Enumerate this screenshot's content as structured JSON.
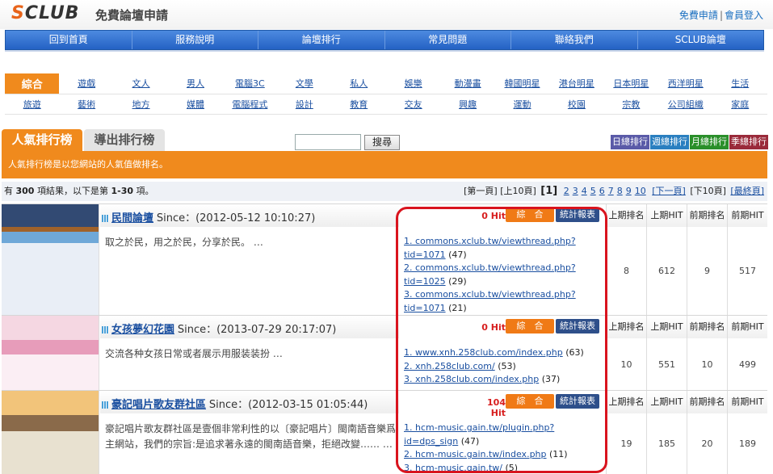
{
  "header": {
    "logo_s": "S",
    "logo_club": "CLUB",
    "slogan": "免費論壇申請",
    "link_free": "免費申請",
    "link_sep": "|",
    "link_login": "會員登入"
  },
  "mainnav": [
    "回到首頁",
    "服務說明",
    "論壇排行",
    "常見問題",
    "聯絡我們",
    "SCLUB論壇"
  ],
  "categories": {
    "row1": [
      "綜合",
      "遊戲",
      "文人",
      "男人",
      "電腦3C",
      "文學",
      "私人",
      "娛樂",
      "動漫畫",
      "韓國明星",
      "港台明星",
      "日本明星",
      "西洋明星",
      "生活"
    ],
    "row2": [
      "旅遊",
      "藝術",
      "地方",
      "媒體",
      "電腦程式",
      "設計",
      "教育",
      "交友",
      "興趣",
      "運動",
      "校園",
      "宗教",
      "公司組織",
      "家庭"
    ]
  },
  "tabs": {
    "active": "人氣排行榜",
    "inactive": "導出排行榜"
  },
  "search": {
    "button": "搜尋"
  },
  "rank_buttons": [
    {
      "label": "日總排行",
      "color": "#5a5aa8"
    },
    {
      "label": "週總排行",
      "color": "#2a7fc0"
    },
    {
      "label": "月總排行",
      "color": "#2a8f2a"
    },
    {
      "label": "季總排行",
      "color": "#9a2a3a"
    }
  ],
  "info_bar": "人氣排行榜是以您網站的人氣值做排名。",
  "results": {
    "prefix": "有",
    "total": "300",
    "middle": "項結果，以下是第",
    "range": "1-30",
    "suffix": "項。"
  },
  "pager": {
    "first": "[第一頁]",
    "prev10": "[上10頁]",
    "current": "[1]",
    "pages": [
      "2",
      "3",
      "4",
      "5",
      "6",
      "7",
      "8",
      "9",
      "10"
    ],
    "next": "[下一頁]",
    "next10": "[下10頁]",
    "last": "[最終頁]"
  },
  "stat_headers": [
    "上期排名",
    "上期HIT",
    "前期排名",
    "前期HIT"
  ],
  "listings": [
    {
      "name": "民間論壇",
      "since": "Since：(2012-05-12 10:10:27)",
      "desc": "取之於民，用之於民，分享於民。 …",
      "hit": "0 Hit",
      "summary_label": "綜　合",
      "stat_label": "統計報表",
      "refs": [
        {
          "url": "1. commons.xclub.tw/viewthread.php?tid=1071",
          "count": "(47)"
        },
        {
          "url": "2. commons.xclub.tw/viewthread.php?tid=1025",
          "count": "(29)"
        },
        {
          "url": "3. commons.xclub.tw/viewthread.php?tid=1071",
          "count": "(21)"
        }
      ],
      "stats": [
        "8",
        "612",
        "9",
        "517"
      ]
    },
    {
      "name": "女孩夢幻花園",
      "since": "Since：(2013-07-29 20:17:07)",
      "desc": "交流各种女孩日常或者展示用服装装扮 …",
      "hit": "0 Hit",
      "summary_label": "綜　合",
      "stat_label": "統計報表",
      "refs": [
        {
          "url": "1. www.xnh.258club.com/index.php",
          "count": "(63)"
        },
        {
          "url": "2. xnh.258club.com/",
          "count": "(53)"
        },
        {
          "url": "3. xnh.258club.com/index.php",
          "count": "(37)"
        }
      ],
      "stats": [
        "10",
        "551",
        "10",
        "499"
      ]
    },
    {
      "name": "豪記唱片歌友群社區",
      "since": "Since：(2012-03-15 01:05:44)",
      "desc": "豪記唱片歌友群社區是壹個非常利性的以〔豪記唱片〕閩南語音樂爲主網站，我們的宗旨:是追求著永遠的閩南語音樂，拒絕改變…… …",
      "hit": "104 Hit",
      "summary_label": "綜　合",
      "stat_label": "統計報表",
      "refs": [
        {
          "url": "1. hcm-music.gain.tw/plugin.php?id=dps_sign",
          "count": "(47)"
        },
        {
          "url": "2. hcm-music.gain.tw/index.php",
          "count": "(11)"
        },
        {
          "url": "3. hcm-music.gain.tw/",
          "count": "(5)"
        }
      ],
      "stats": [
        "19",
        "185",
        "20",
        "189"
      ]
    }
  ]
}
